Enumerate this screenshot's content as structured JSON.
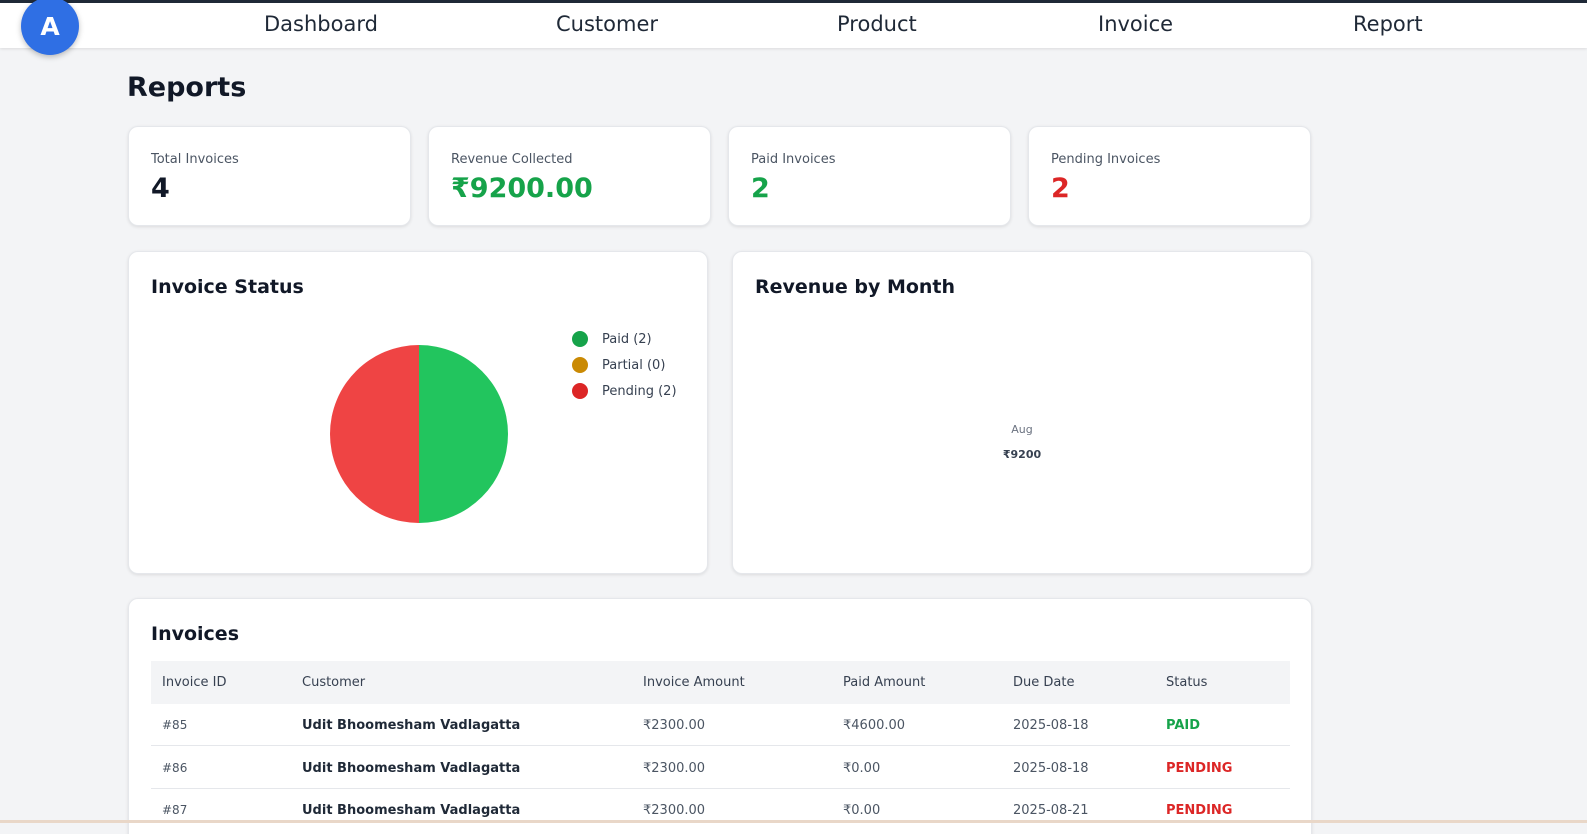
{
  "nav": {
    "logo_letter": "A",
    "items": [
      "Dashboard",
      "Customer",
      "Product",
      "Invoice",
      "Report"
    ]
  },
  "page": {
    "title": "Reports"
  },
  "stats": [
    {
      "label": "Total Invoices",
      "value": "4",
      "color": "#111827"
    },
    {
      "label": "Revenue Collected",
      "value": "₹9200.00",
      "color": "#16a34a"
    },
    {
      "label": "Paid Invoices",
      "value": "2",
      "color": "#16a34a"
    },
    {
      "label": "Pending Invoices",
      "value": "2",
      "color": "#dc2626"
    }
  ],
  "invoice_status": {
    "title": "Invoice Status",
    "legend": [
      {
        "label": "Paid (2)",
        "color": "#16a34a"
      },
      {
        "label": "Partial (0)",
        "color": "#ca8a04"
      },
      {
        "label": "Pending (2)",
        "color": "#dc2626"
      }
    ]
  },
  "revenue_by_month": {
    "title": "Revenue by Month",
    "month": "Aug",
    "amount": "₹9200"
  },
  "chart_data": {
    "type": "pie",
    "categories": [
      "Paid",
      "Partial",
      "Pending"
    ],
    "values": [
      2,
      0,
      2
    ],
    "colors": [
      "#22c55e",
      "#ca8a04",
      "#ef4444"
    ],
    "title": "Invoice Status",
    "legend": "right"
  },
  "invoices": {
    "title": "Invoices",
    "columns": [
      "Invoice ID",
      "Customer",
      "Invoice Amount",
      "Paid Amount",
      "Due Date",
      "Status"
    ],
    "rows": [
      {
        "id": "#85",
        "customer": "Udit Bhoomesham Vadlagatta",
        "amount": "₹2300.00",
        "paid": "₹4600.00",
        "due": "2025-08-18",
        "status": "PAID",
        "status_color": "#16a34a"
      },
      {
        "id": "#86",
        "customer": "Udit Bhoomesham Vadlagatta",
        "amount": "₹2300.00",
        "paid": "₹0.00",
        "due": "2025-08-18",
        "status": "PENDING",
        "status_color": "#dc2626"
      },
      {
        "id": "#87",
        "customer": "Udit Bhoomesham Vadlagatta",
        "amount": "₹2300.00",
        "paid": "₹0.00",
        "due": "2025-08-21",
        "status": "PENDING",
        "status_color": "#dc2626"
      }
    ]
  }
}
